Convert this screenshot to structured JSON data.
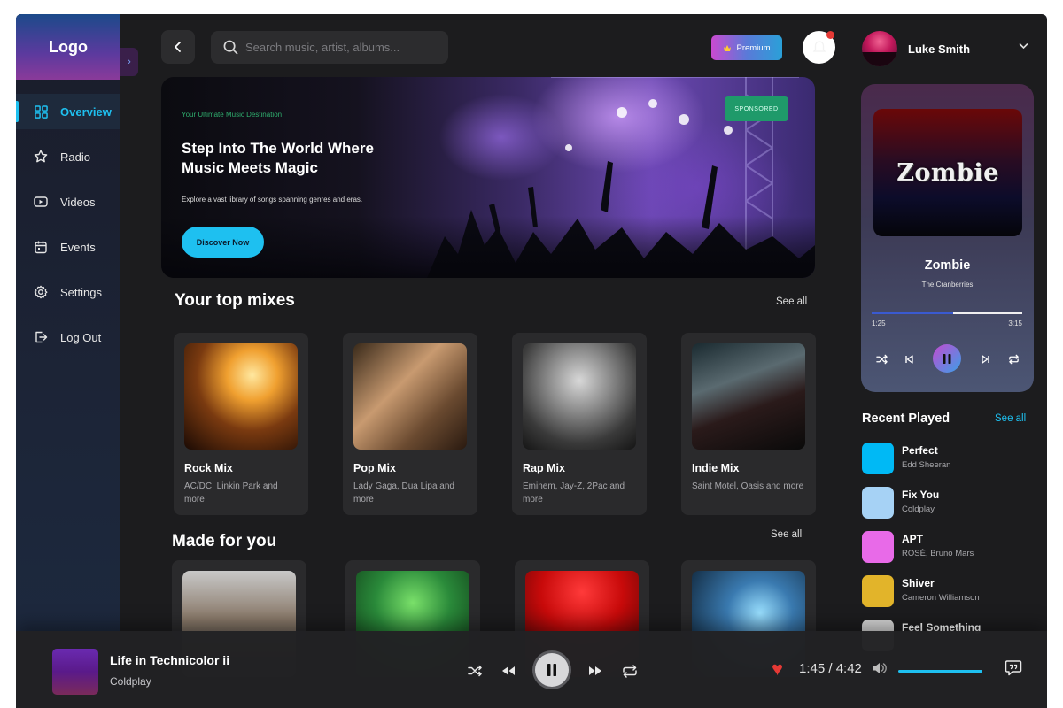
{
  "sidebar": {
    "logo": "Logo",
    "items": [
      {
        "label": "Overview",
        "icon": "grid-icon"
      },
      {
        "label": "Radio",
        "icon": "star-icon"
      },
      {
        "label": "Videos",
        "icon": "play-icon"
      },
      {
        "label": "Events",
        "icon": "calendar-icon"
      },
      {
        "label": "Settings",
        "icon": "gear-icon"
      },
      {
        "label": "Log Out",
        "icon": "logout-icon"
      }
    ]
  },
  "header": {
    "search_placeholder": "Search music, artist, albums...",
    "premium_label": "Premium",
    "user_name": "Luke Smith"
  },
  "hero": {
    "eyebrow": "Your Ultimate Music Destination",
    "title": "Step Into The World Where Music Meets Magic",
    "subtitle": "Explore a vast library of songs spanning genres and eras.",
    "button": "Discover Now",
    "badge": "SPONSORED"
  },
  "top_mixes": {
    "title": "Your top mixes",
    "see_all": "See all",
    "items": [
      {
        "title": "Rock Mix",
        "subtitle": "AC/DC, Linkin Park and more"
      },
      {
        "title": "Pop Mix",
        "subtitle": "Lady Gaga, Dua Lipa and more"
      },
      {
        "title": "Rap Mix",
        "subtitle": "Eminem, Jay-Z, 2Pac and more"
      },
      {
        "title": "Indie Mix",
        "subtitle": "Saint Motel, Oasis and more"
      }
    ]
  },
  "made_for_you": {
    "title": "Made for you",
    "see_all": "See all"
  },
  "now_playing": {
    "album_text": "Zombie",
    "title": "Zombie",
    "artist": "The Cranberries",
    "current_time": "1:25",
    "duration": "3:15",
    "progress": 0.54
  },
  "recent": {
    "title": "Recent Played",
    "see_all": "See all",
    "items": [
      {
        "name": "Perfect",
        "artist": "Edd Sheeran",
        "color": "#00b9f5"
      },
      {
        "name": "Fix You",
        "artist": "Coldplay",
        "color": "#a6d2f5"
      },
      {
        "name": "APT",
        "artist": "ROSÈ, Bruno Mars",
        "color": "#e86ae8"
      },
      {
        "name": "Shiver",
        "artist": "Cameron Williamson",
        "color": "#e2b42a"
      },
      {
        "name": "Feel Something",
        "artist": "",
        "color": "#d8d8d8"
      }
    ]
  },
  "player": {
    "title": "Life in Technicolor ii",
    "artist": "Coldplay",
    "time": "1:45 / 4:42",
    "volume": 1.0
  },
  "colors": {
    "accent": "#1ec0f0",
    "background": "#1c1c1e",
    "card": "#2a2a2c",
    "heart": "#e53935"
  }
}
